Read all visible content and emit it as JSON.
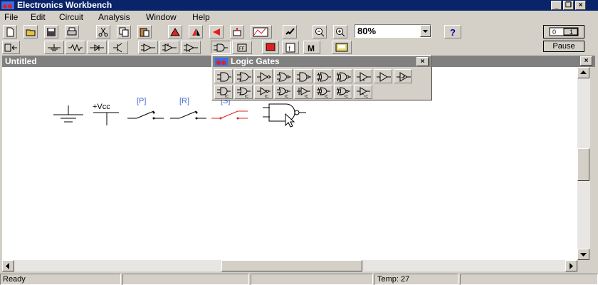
{
  "app": {
    "title": "Electronics Workbench"
  },
  "menu": [
    "File",
    "Edit",
    "Circuit",
    "Analysis",
    "Window",
    "Help"
  ],
  "toolbar": {
    "zoom": "80%",
    "pause_label": "Pause",
    "switch_label": "0 1"
  },
  "document": {
    "title": "Untitled"
  },
  "palette": {
    "title": "Logic Gates"
  },
  "circuit": {
    "vcc_label": "+Vcc",
    "switch_labels": [
      "[P]",
      "[R]",
      "[S]"
    ]
  },
  "status": {
    "ready": "Ready",
    "temp": "Temp:  27"
  },
  "colors": {
    "titlebar": "#0a246a",
    "inactive_title": "#808080",
    "selected_switch": "#e02020",
    "label_blue": "#4a6ad6"
  }
}
